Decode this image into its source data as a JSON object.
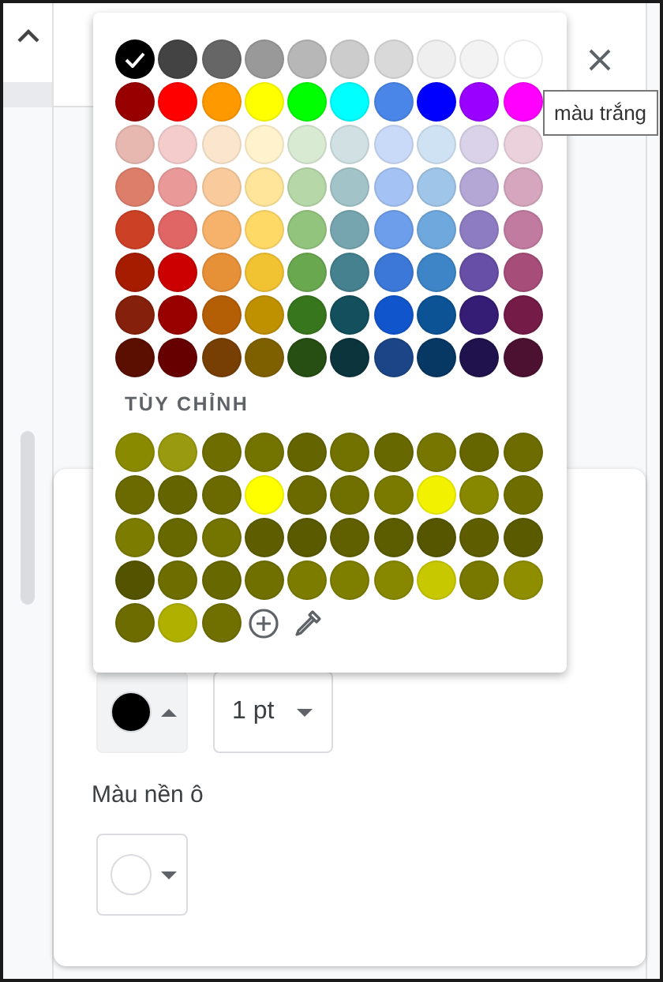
{
  "palette": {
    "rows": [
      [
        {
          "color": "#000000",
          "selected": true
        },
        {
          "color": "#434343",
          "selected": false
        },
        {
          "color": "#666666",
          "selected": false
        },
        {
          "color": "#999999",
          "selected": false
        },
        {
          "color": "#b7b7b7",
          "selected": false
        },
        {
          "color": "#cccccc",
          "selected": false
        },
        {
          "color": "#d9d9d9",
          "selected": false
        },
        {
          "color": "#efefef",
          "selected": false
        },
        {
          "color": "#f3f3f3",
          "selected": false
        },
        {
          "color": "#ffffff",
          "selected": false
        }
      ],
      [
        {
          "color": "#980000",
          "selected": false
        },
        {
          "color": "#ff0000",
          "selected": false
        },
        {
          "color": "#ff9900",
          "selected": false
        },
        {
          "color": "#ffff00",
          "selected": false
        },
        {
          "color": "#00ff00",
          "selected": false
        },
        {
          "color": "#00ffff",
          "selected": false
        },
        {
          "color": "#4a86e8",
          "selected": false
        },
        {
          "color": "#0000ff",
          "selected": false
        },
        {
          "color": "#9900ff",
          "selected": false
        },
        {
          "color": "#ff00ff",
          "selected": false
        }
      ],
      [
        {
          "color": "#e6b8af",
          "selected": false
        },
        {
          "color": "#f4cccc",
          "selected": false
        },
        {
          "color": "#fce5cd",
          "selected": false
        },
        {
          "color": "#fff2cc",
          "selected": false
        },
        {
          "color": "#d9ead3",
          "selected": false
        },
        {
          "color": "#d0e0e3",
          "selected": false
        },
        {
          "color": "#c9daf8",
          "selected": false
        },
        {
          "color": "#cfe2f3",
          "selected": false
        },
        {
          "color": "#d9d2e9",
          "selected": false
        },
        {
          "color": "#ead1dc",
          "selected": false
        }
      ],
      [
        {
          "color": "#dd7e6b",
          "selected": false
        },
        {
          "color": "#ea9999",
          "selected": false
        },
        {
          "color": "#f9cb9c",
          "selected": false
        },
        {
          "color": "#ffe599",
          "selected": false
        },
        {
          "color": "#b6d7a8",
          "selected": false
        },
        {
          "color": "#a2c4c9",
          "selected": false
        },
        {
          "color": "#a4c2f4",
          "selected": false
        },
        {
          "color": "#9fc5e8",
          "selected": false
        },
        {
          "color": "#b4a7d6",
          "selected": false
        },
        {
          "color": "#d5a6bd",
          "selected": false
        }
      ],
      [
        {
          "color": "#cc4125",
          "selected": false
        },
        {
          "color": "#e06666",
          "selected": false
        },
        {
          "color": "#f6b26b",
          "selected": false
        },
        {
          "color": "#ffd966",
          "selected": false
        },
        {
          "color": "#93c47d",
          "selected": false
        },
        {
          "color": "#76a5af",
          "selected": false
        },
        {
          "color": "#6d9eeb",
          "selected": false
        },
        {
          "color": "#6fa8dc",
          "selected": false
        },
        {
          "color": "#8e7cc3",
          "selected": false
        },
        {
          "color": "#c27ba0",
          "selected": false
        }
      ],
      [
        {
          "color": "#a61c00",
          "selected": false
        },
        {
          "color": "#cc0000",
          "selected": false
        },
        {
          "color": "#e69138",
          "selected": false
        },
        {
          "color": "#f1c232",
          "selected": false
        },
        {
          "color": "#6aa84f",
          "selected": false
        },
        {
          "color": "#45818e",
          "selected": false
        },
        {
          "color": "#3c78d8",
          "selected": false
        },
        {
          "color": "#3d85c6",
          "selected": false
        },
        {
          "color": "#674ea7",
          "selected": false
        },
        {
          "color": "#a64d79",
          "selected": false
        }
      ],
      [
        {
          "color": "#85200c",
          "selected": false
        },
        {
          "color": "#990000",
          "selected": false
        },
        {
          "color": "#b45f06",
          "selected": false
        },
        {
          "color": "#bf9000",
          "selected": false
        },
        {
          "color": "#38761d",
          "selected": false
        },
        {
          "color": "#134f5c",
          "selected": false
        },
        {
          "color": "#1155cc",
          "selected": false
        },
        {
          "color": "#0b5394",
          "selected": false
        },
        {
          "color": "#351c75",
          "selected": false
        },
        {
          "color": "#741b47",
          "selected": false
        }
      ],
      [
        {
          "color": "#5b0f00",
          "selected": false
        },
        {
          "color": "#660000",
          "selected": false
        },
        {
          "color": "#783f04",
          "selected": false
        },
        {
          "color": "#7f6000",
          "selected": false
        },
        {
          "color": "#274e13",
          "selected": false
        },
        {
          "color": "#0c343d",
          "selected": false
        },
        {
          "color": "#1c4587",
          "selected": false
        },
        {
          "color": "#073763",
          "selected": false
        },
        {
          "color": "#20124d",
          "selected": false
        },
        {
          "color": "#4c1130",
          "selected": false
        }
      ]
    ],
    "custom_heading": "TÙY CHỈNH",
    "custom": [
      {
        "color": "#8a8a00"
      },
      {
        "color": "#9a9a10"
      },
      {
        "color": "#6e6e00"
      },
      {
        "color": "#737300"
      },
      {
        "color": "#646400"
      },
      {
        "color": "#727200"
      },
      {
        "color": "#686800"
      },
      {
        "color": "#767600"
      },
      {
        "color": "#666600"
      },
      {
        "color": "#6c6c00"
      },
      {
        "color": "#6a6a00"
      },
      {
        "color": "#646400"
      },
      {
        "color": "#6a6a00"
      },
      {
        "color": "#ffff00"
      },
      {
        "color": "#6a6a00"
      },
      {
        "color": "#707000"
      },
      {
        "color": "#7a7a00"
      },
      {
        "color": "#f2f200"
      },
      {
        "color": "#878700"
      },
      {
        "color": "#6e6e00"
      },
      {
        "color": "#7c7c00"
      },
      {
        "color": "#686800"
      },
      {
        "color": "#747400"
      },
      {
        "color": "#5e5e00"
      },
      {
        "color": "#5a5a00"
      },
      {
        "color": "#606000"
      },
      {
        "color": "#5c5c00"
      },
      {
        "color": "#565600"
      },
      {
        "color": "#5e5e00"
      },
      {
        "color": "#5a5a00"
      },
      {
        "color": "#545400"
      },
      {
        "color": "#6e6e00"
      },
      {
        "color": "#686800"
      },
      {
        "color": "#707000"
      },
      {
        "color": "#7c7c00"
      },
      {
        "color": "#7e7e00"
      },
      {
        "color": "#878700"
      },
      {
        "color": "#c8c800"
      },
      {
        "color": "#787800"
      },
      {
        "color": "#8e8e00"
      },
      {
        "color": "#6c6c00"
      },
      {
        "color": "#b0b000"
      },
      {
        "color": "#707000"
      }
    ]
  },
  "tooltip": "màu trắng",
  "border": {
    "color": "#000000",
    "expanded": true,
    "weight": "1 pt"
  },
  "fill": {
    "label": "Màu nền ô",
    "color": "#ffffff",
    "expanded": false
  }
}
